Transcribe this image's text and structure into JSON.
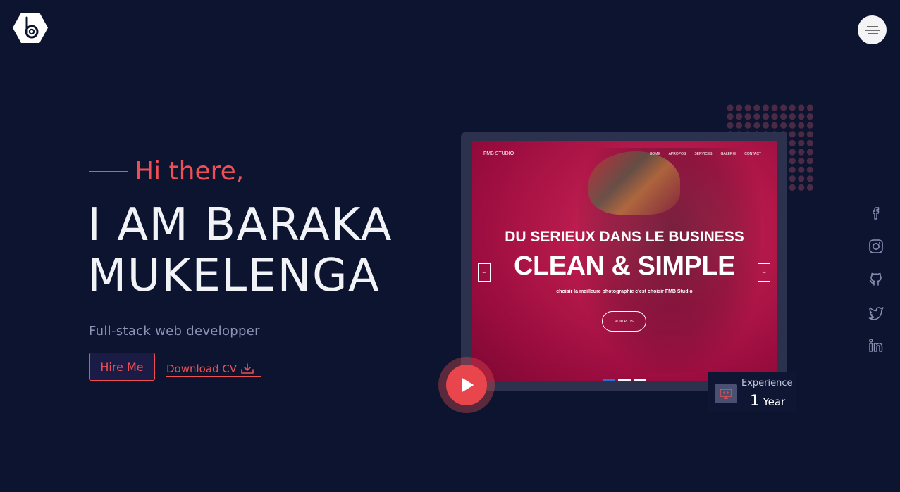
{
  "header": {
    "logo_icon": "hexagon-b-logo",
    "menu_icon": "hamburger-menu-icon"
  },
  "hero": {
    "greeting": "Hi there,",
    "name_line1": "I AM BARAKA",
    "name_line2": "MUKELENGA",
    "role": "Full-stack web developper",
    "hire_label": "Hire Me",
    "download_label": "Download CV",
    "download_icon": "download-icon"
  },
  "preview": {
    "site_brand": "FMB STUDIO",
    "site_nav": [
      "HOME",
      "APROPOS",
      "SERVICES",
      "GALERIE",
      "CONTACT"
    ],
    "site_subheadline": "DU SERIEUX DANS LE BUSINESS",
    "site_headline": "CLEAN & SIMPLE",
    "site_tagline": "choisir la meilleure photographie c'est choisir FMB Studio",
    "site_button": "VOIR PLUS",
    "prev_arrow": "←",
    "next_arrow": "→",
    "play_icon": "play-icon"
  },
  "experience": {
    "label": "Experience",
    "value": "1",
    "unit": "Year",
    "icon": "monitor-code-icon"
  },
  "social": [
    "facebook-icon",
    "instagram-icon",
    "github-icon",
    "twitter-icon",
    "linkedin-icon"
  ],
  "colors": {
    "background": "#0d1430",
    "accent": "#ef4f53",
    "muted_text": "#8d93b5",
    "frame": "#2c324e",
    "social_icon": "#8a90b3"
  }
}
